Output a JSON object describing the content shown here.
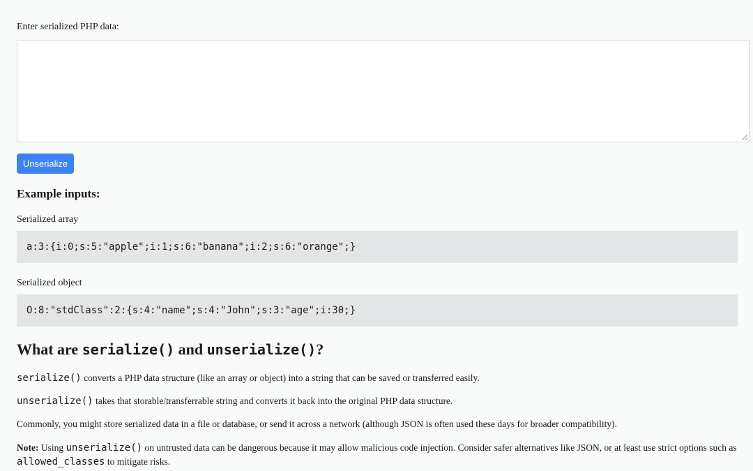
{
  "form": {
    "label": "Enter serialized PHP data:",
    "textarea_value": "",
    "button_label": "Unserialize"
  },
  "examples": {
    "heading": "Example inputs:",
    "items": [
      {
        "label": "Serialized array",
        "code": "a:3:{i:0;s:5:\"apple\";i:1;s:6:\"banana\";i:2;s:6:\"orange\";}"
      },
      {
        "label": "Serialized object",
        "code": "O:8:\"stdClass\":2:{s:4:\"name\";s:4:\"John\";s:3:\"age\";i:30;}"
      }
    ]
  },
  "about": {
    "heading": {
      "part1": "What are ",
      "code1": "serialize()",
      "part2": " and ",
      "code2": "unserialize()",
      "part3": "?"
    },
    "p1": {
      "code": "serialize()",
      "text": " converts a PHP data structure (like an array or object) into a string that can be saved or transferred easily."
    },
    "p2": {
      "code": "unserialize()",
      "text": " takes that storable/transferrable string and converts it back into the original PHP data structure."
    },
    "p3": "Commonly, you might store serialized data in a file or database, or send it across a network (although JSON is often used these days for broader compatibility).",
    "note": {
      "label": "Note:",
      "text1": " Using ",
      "code1": "unserialize()",
      "text2": " on untrusted data can be dangerous because it may allow malicious code injection. Consider safer alternatives like JSON, or at least use strict options such as ",
      "code2": "allowed_classes",
      "text3": " to mitigate risks."
    }
  }
}
